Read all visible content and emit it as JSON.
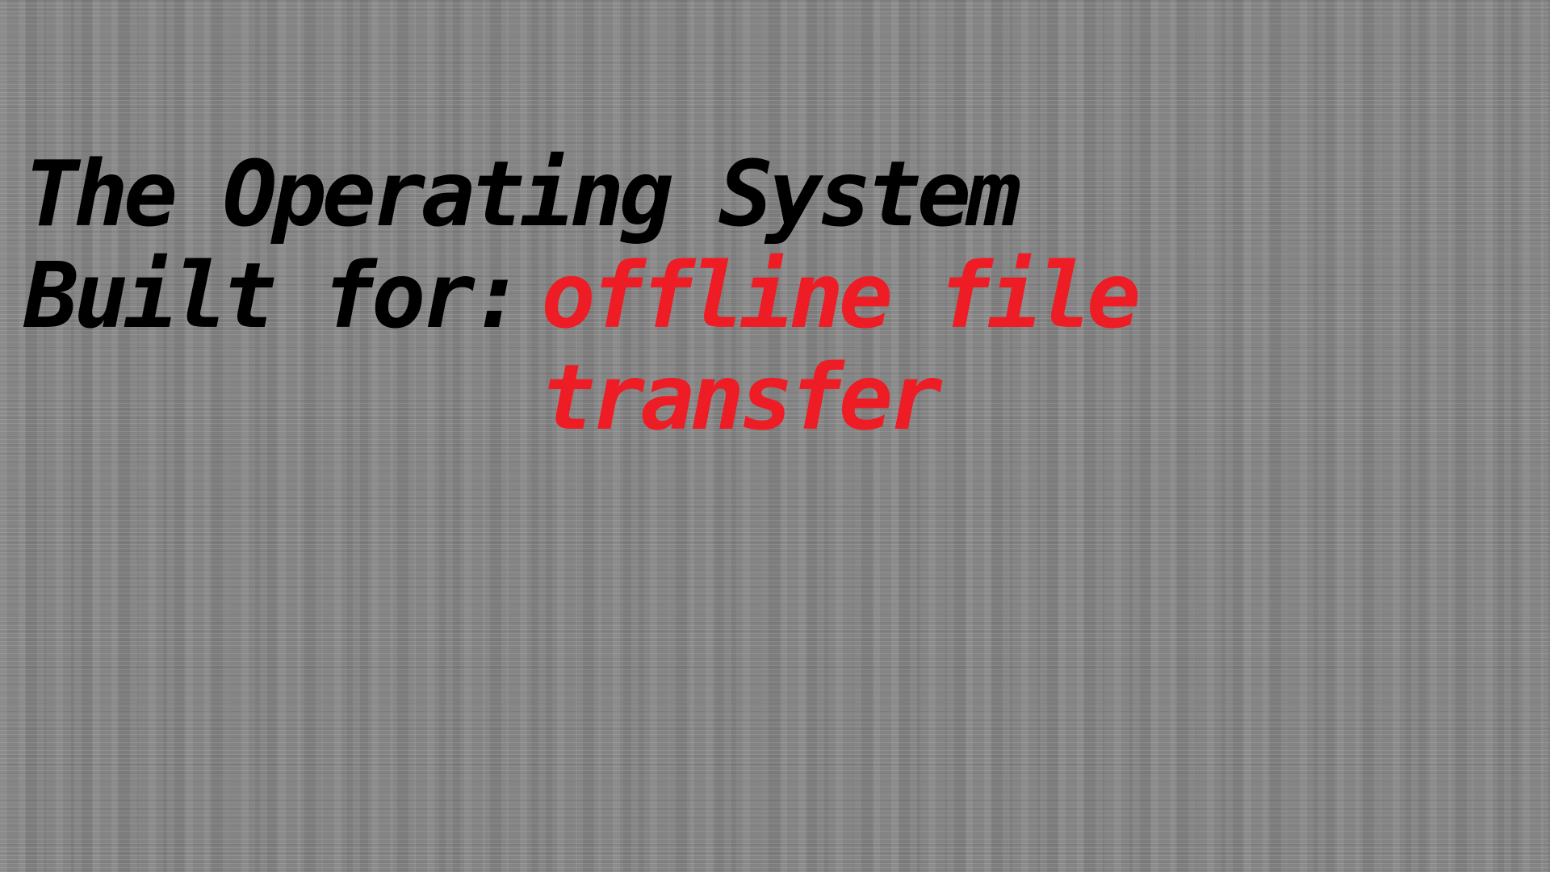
{
  "headline": {
    "line1": "The Operating System",
    "prefix": "Built for:",
    "highlight": "offline file\ntransfer"
  },
  "colors": {
    "background": "#7d7d7d",
    "text": "#000000",
    "highlight": "#ee1c24"
  }
}
